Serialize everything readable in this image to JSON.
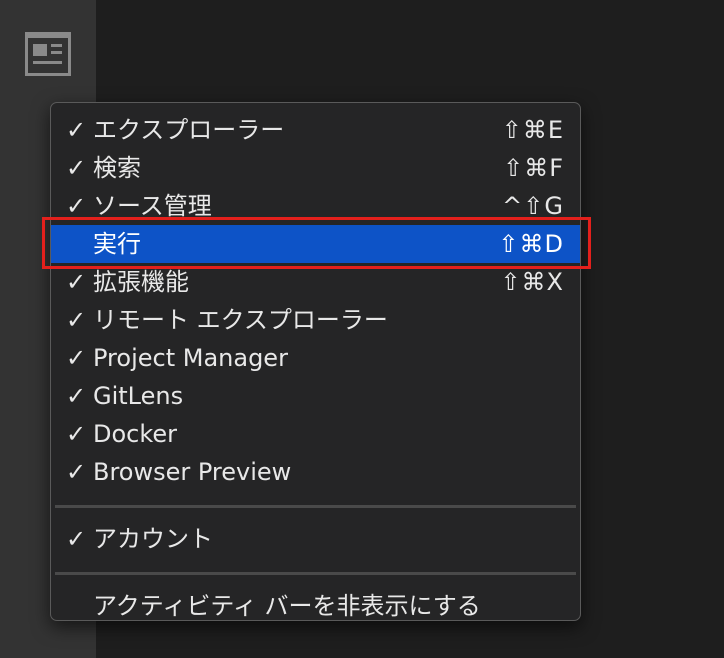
{
  "activity_bar": {
    "icon": "layout-panel-icon"
  },
  "menu": {
    "items": [
      {
        "checked": true,
        "label": "エクスプローラー",
        "shortcut": "⇧⌘E"
      },
      {
        "checked": true,
        "label": "検索",
        "shortcut": "⇧⌘F"
      },
      {
        "checked": true,
        "label": "ソース管理",
        "shortcut": "^⇧G"
      },
      {
        "checked": false,
        "label": "実行",
        "shortcut": "⇧⌘D",
        "selected": true
      },
      {
        "checked": true,
        "label": "拡張機能",
        "shortcut": "⇧⌘X"
      },
      {
        "checked": true,
        "label": "リモート エクスプローラー",
        "shortcut": ""
      },
      {
        "checked": true,
        "label": "Project Manager",
        "shortcut": ""
      },
      {
        "checked": true,
        "label": "GitLens",
        "shortcut": ""
      },
      {
        "checked": true,
        "label": "Docker",
        "shortcut": ""
      },
      {
        "checked": true,
        "label": "Browser Preview",
        "shortcut": ""
      }
    ],
    "account": {
      "checked": true,
      "label": "アカウント"
    },
    "hide_activity_bar": {
      "label": "アクティビティ バーを非表示にする"
    },
    "check_glyph": "✓",
    "selected_color": "#0d53c7",
    "highlight_border_color": "#e3201c"
  }
}
